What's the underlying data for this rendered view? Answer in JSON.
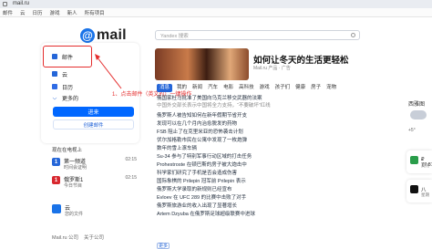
{
  "browser": {
    "url": "mail.ru",
    "bookmarks": [
      "邮件",
      "云",
      "日历",
      "游戏",
      "新人",
      "所有项目"
    ]
  },
  "logo": {
    "text": "mail"
  },
  "mail_card": {
    "services": [
      {
        "label": "邮件",
        "icon": "mail-icon",
        "color": "#2566d8"
      },
      {
        "label": "云",
        "icon": "cloud-icon",
        "color": "#2566d8"
      },
      {
        "label": "日历",
        "icon": "calendar-icon",
        "color": "#2f6ce5"
      },
      {
        "label": "更多的",
        "icon": "chevron-down-icon",
        "color": "#2566d8"
      }
    ],
    "login_label": "进来",
    "create_label": "创建邮件"
  },
  "tv": {
    "title": "现在在电视上",
    "rows": [
      {
        "num": "1",
        "channel": "第一频道",
        "show": "时间会证明",
        "time": "02:15",
        "color": "#2566d8"
      },
      {
        "num": "1",
        "channel": "俄罗斯1",
        "show": "今日节目",
        "time": "02:15",
        "color": "#d8282f"
      }
    ]
  },
  "cloud": {
    "title": "云",
    "subtitle": "您的文件"
  },
  "footer": [
    "Mail.ru 公司",
    "关于公司"
  ],
  "annotation": {
    "text": "1、点击邮件（英文的）一键操作"
  },
  "search": {
    "placeholder": "Yandex 搜索"
  },
  "hero": {
    "title": "如何让冬天的生活更轻松",
    "meta": "Mail.ru 产品 · 广告"
  },
  "tabs": [
    "消息",
    "我的",
    "新闻",
    "汽车",
    "电影",
    "高科技",
    "游戏",
    "孩子们",
    "健康",
    "房子",
    "宠物"
  ],
  "news": [
    "俄国家杜马批准了美国向乌克兰移交武器的法案",
    "中国外交部长表示中国将全力支持，“不要破坏”红线",
    "俄罗斯人被告知如何在新年假期节省开支",
    "发现可以在几个月内治愈脱发的药物",
    "FSB 阻止了在克里米亚的恐怖袭击计划",
    "伏尔加格勒市民在公寓中发现了一枚炮弹",
    "数年的雪上滚车辆",
    "Su-34 参与了特别军事行动区域的打击任务",
    "Prohestroste 在顿巴斯的房子被大炮击中",
    "科学家们研究了手机是否会造成伤害",
    "国际象棋的 Prilepin 冠军前 Prilepin 表示",
    "俄罗斯大学录取的新规则已经宣布",
    "Evloev 在 UFC 289 的比赛中击败了对手",
    "俄罗斯旅游业的收入出现了显著增长",
    "Artem Dzyuba 在俄罗斯足球超级联赛中进球"
  ],
  "more_label": "更多",
  "sidebar": {
    "weather_label": "西雅图",
    "temp": "+5°",
    "widgets": [
      {
        "top": "₽ 77.81",
        "sub": "美元",
        "color": "#2a9d4a"
      },
      {
        "top": "八",
        "sub": "星期",
        "color": "#111111"
      }
    ]
  }
}
